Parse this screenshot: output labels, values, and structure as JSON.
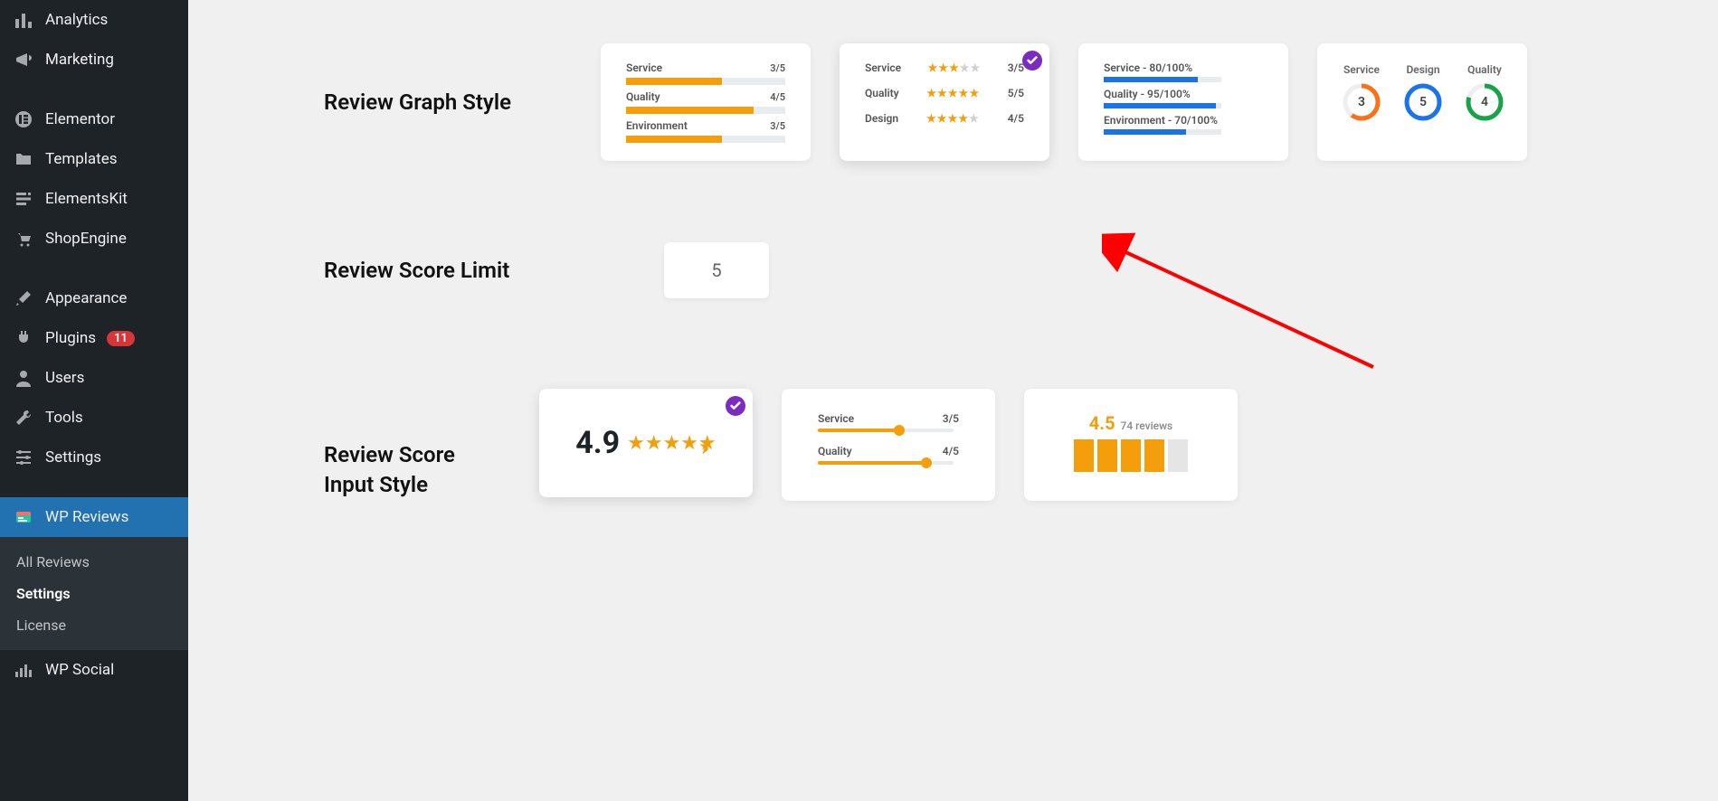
{
  "sidebar": {
    "items": [
      {
        "label": "Analytics"
      },
      {
        "label": "Marketing"
      },
      {
        "label": "Elementor"
      },
      {
        "label": "Templates"
      },
      {
        "label": "ElementsKit"
      },
      {
        "label": "ShopEngine"
      },
      {
        "label": "Appearance"
      },
      {
        "label": "Plugins",
        "badge": "11"
      },
      {
        "label": "Users"
      },
      {
        "label": "Tools"
      },
      {
        "label": "Settings"
      },
      {
        "label": "WP Reviews"
      },
      {
        "label": "WP Social"
      }
    ],
    "submenu": [
      {
        "label": "All Reviews"
      },
      {
        "label": "Settings"
      },
      {
        "label": "License"
      }
    ]
  },
  "sections": {
    "graph_heading": "Review Graph Style",
    "score_limit_heading": "Review Score Limit",
    "input_style_heading_line1": "Review Score",
    "input_style_heading_line2": "Input Style"
  },
  "graph_styles": {
    "a": {
      "rows": [
        {
          "label": "Service",
          "value": "3/5",
          "pct": 60
        },
        {
          "label": "Quality",
          "value": "4/5",
          "pct": 80
        },
        {
          "label": "Environment",
          "value": "3/5",
          "pct": 60
        }
      ],
      "color": "#f59e0b"
    },
    "b": {
      "rows": [
        {
          "label": "Service",
          "value": "3/5",
          "filled": 3
        },
        {
          "label": "Quality",
          "value": "5/5",
          "filled": 5
        },
        {
          "label": "Design",
          "value": "4/5",
          "filled": 4
        }
      ]
    },
    "c": {
      "rows": [
        {
          "label": "Service - 80/100%",
          "pct": 80
        },
        {
          "label": "Quality - 95/100%",
          "pct": 95
        },
        {
          "label": "Environment - 70/100%",
          "pct": 70
        }
      ]
    },
    "d": {
      "cols": [
        {
          "label": "Service",
          "value": "3",
          "color": "#f97316",
          "frac": 0.6
        },
        {
          "label": "Design",
          "value": "5",
          "color": "#1a73e8",
          "frac": 1.0
        },
        {
          "label": "Quality",
          "value": "4",
          "color": "#16a34a",
          "frac": 0.8
        }
      ]
    }
  },
  "score_limit": {
    "value": "5"
  },
  "input_styles": {
    "e": {
      "score": "4.9"
    },
    "f": {
      "rows": [
        {
          "label": "Service",
          "value": "3/5",
          "pct": 60
        },
        {
          "label": "Quality",
          "value": "4/5",
          "pct": 80
        }
      ]
    },
    "g": {
      "score": "4.5",
      "count_text": "74 reviews"
    }
  }
}
